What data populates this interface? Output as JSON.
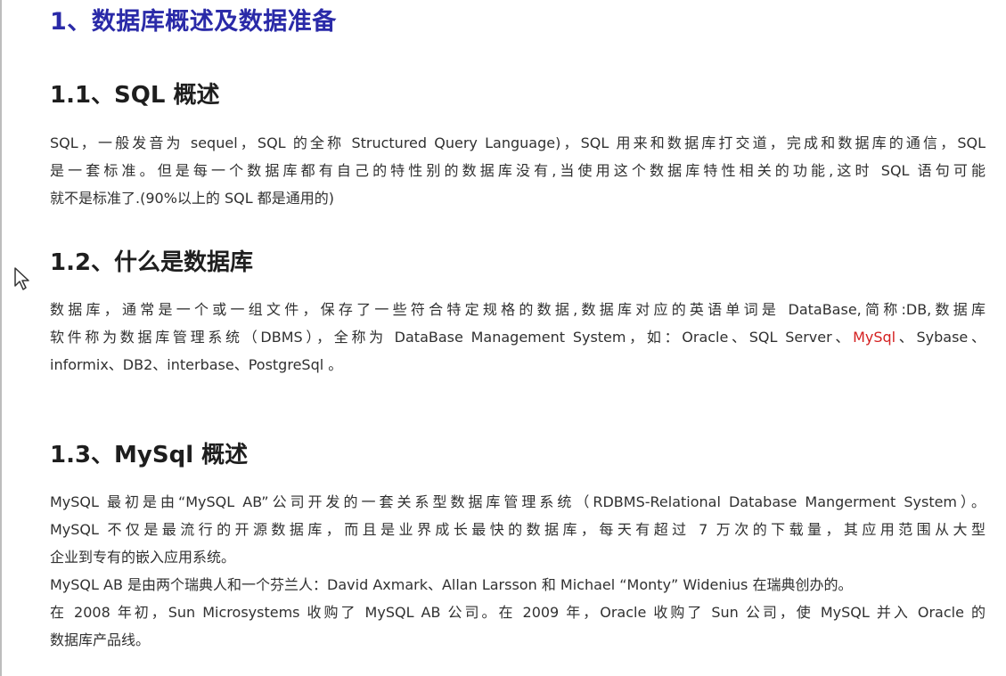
{
  "heading": "1、数据库概述及数据准备",
  "sections": [
    {
      "title": "1.1、SQL 概述",
      "lines": [
        "SQL，一般发音为 sequel，SQL 的全称 Structured Query Language)，SQL 用来和数据库打交道，完成和数据库的通信，SQL",
        "是一套标准。但是每一个数据库都有自己的特性别的数据库没有,当使用这个数据库特性相关的功能,这时 SQL 语句可能",
        "就不是标准了.(90%以上的 SQL 都是通用的)"
      ]
    },
    {
      "title": "1.2、什么是数据库",
      "line1": "数据库，通常是一个或一组文件，保存了一些符合特定规格的数据,数据库对应的英语单词是 DataBase,简称:DB,数据库",
      "line2_before": "软件称为数据库管理系统（DBMS），全称为 DataBase Management System，如：Oracle、SQL Server、",
      "line2_highlight": "MySql",
      "line2_after": "、Sybase、",
      "line3": "informix、DB2、interbase、PostgreSql 。"
    },
    {
      "title": "1.3、MySql 概述",
      "lines": [
        "MySQL 最初是由“MySQL AB”公司开发的一套关系型数据库管理系统（RDBMS-Relational Database Mangerment System）。",
        "MySQL 不仅是最流行的开源数据库，而且是业界成长最快的数据库，每天有超过 7 万次的下载量，其应用范围从大型",
        "企业到专有的嵌入应用系统。",
        "MySQL AB 是由两个瑞典人和一个芬兰人：David Axmark、Allan Larsson 和 Michael “Monty” Widenius 在瑞典创办的。",
        "在 2008 年初，Sun Microsystems 收购了 MySQL AB 公司。在 2009 年，Oracle 收购了 Sun 公司，使 MySQL 并入 Oracle 的",
        "数据库产品线。"
      ]
    }
  ],
  "colors": {
    "heading": "#2a2aa8",
    "highlight": "#d42020",
    "text": "#303030"
  },
  "icons": [
    "mouse-cursor-icon"
  ]
}
